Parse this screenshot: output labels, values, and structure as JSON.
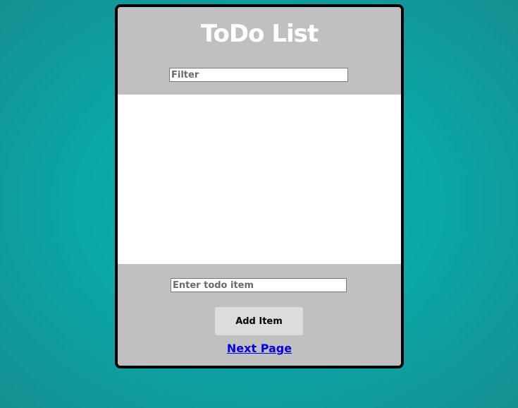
{
  "header": {
    "title": "ToDo List",
    "filter_placeholder": "Filter"
  },
  "list": {
    "items": []
  },
  "footer": {
    "todo_placeholder": "Enter todo item",
    "add_button_label": "Add Item",
    "next_link_label": "Next Page"
  },
  "colors": {
    "background_accent": "#04bcbc",
    "card_panel": "#c0c0c0",
    "card_border": "#000000",
    "list_background": "#ffffff",
    "button_background": "#dcdcdc",
    "link": "#0000ee"
  }
}
